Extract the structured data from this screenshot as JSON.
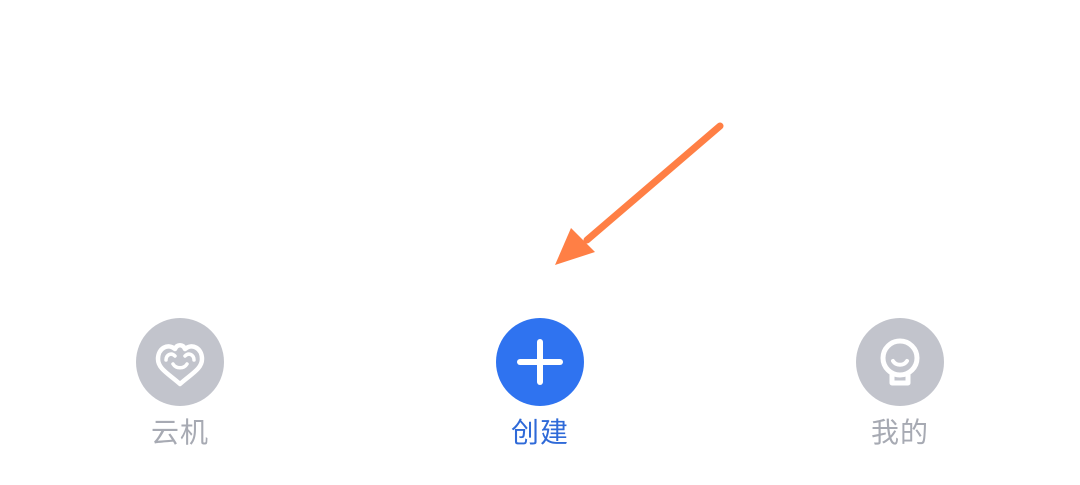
{
  "tabbar": {
    "tabs": [
      {
        "id": "yunji",
        "label": "云机",
        "icon": "cloud-heart-icon",
        "active": false
      },
      {
        "id": "create",
        "label": "创建",
        "icon": "plus-icon",
        "active": true
      },
      {
        "id": "mine",
        "label": "我的",
        "icon": "profile-face-icon",
        "active": false
      }
    ]
  },
  "annotation": {
    "type": "arrow",
    "target": "create"
  },
  "colors": {
    "inactive_icon_bg": "#c2c4cc",
    "inactive_label": "#a7aab3",
    "active_icon_bg": "#2f73f0",
    "active_label": "#2f6ad8",
    "arrow": "#ff7f45"
  }
}
